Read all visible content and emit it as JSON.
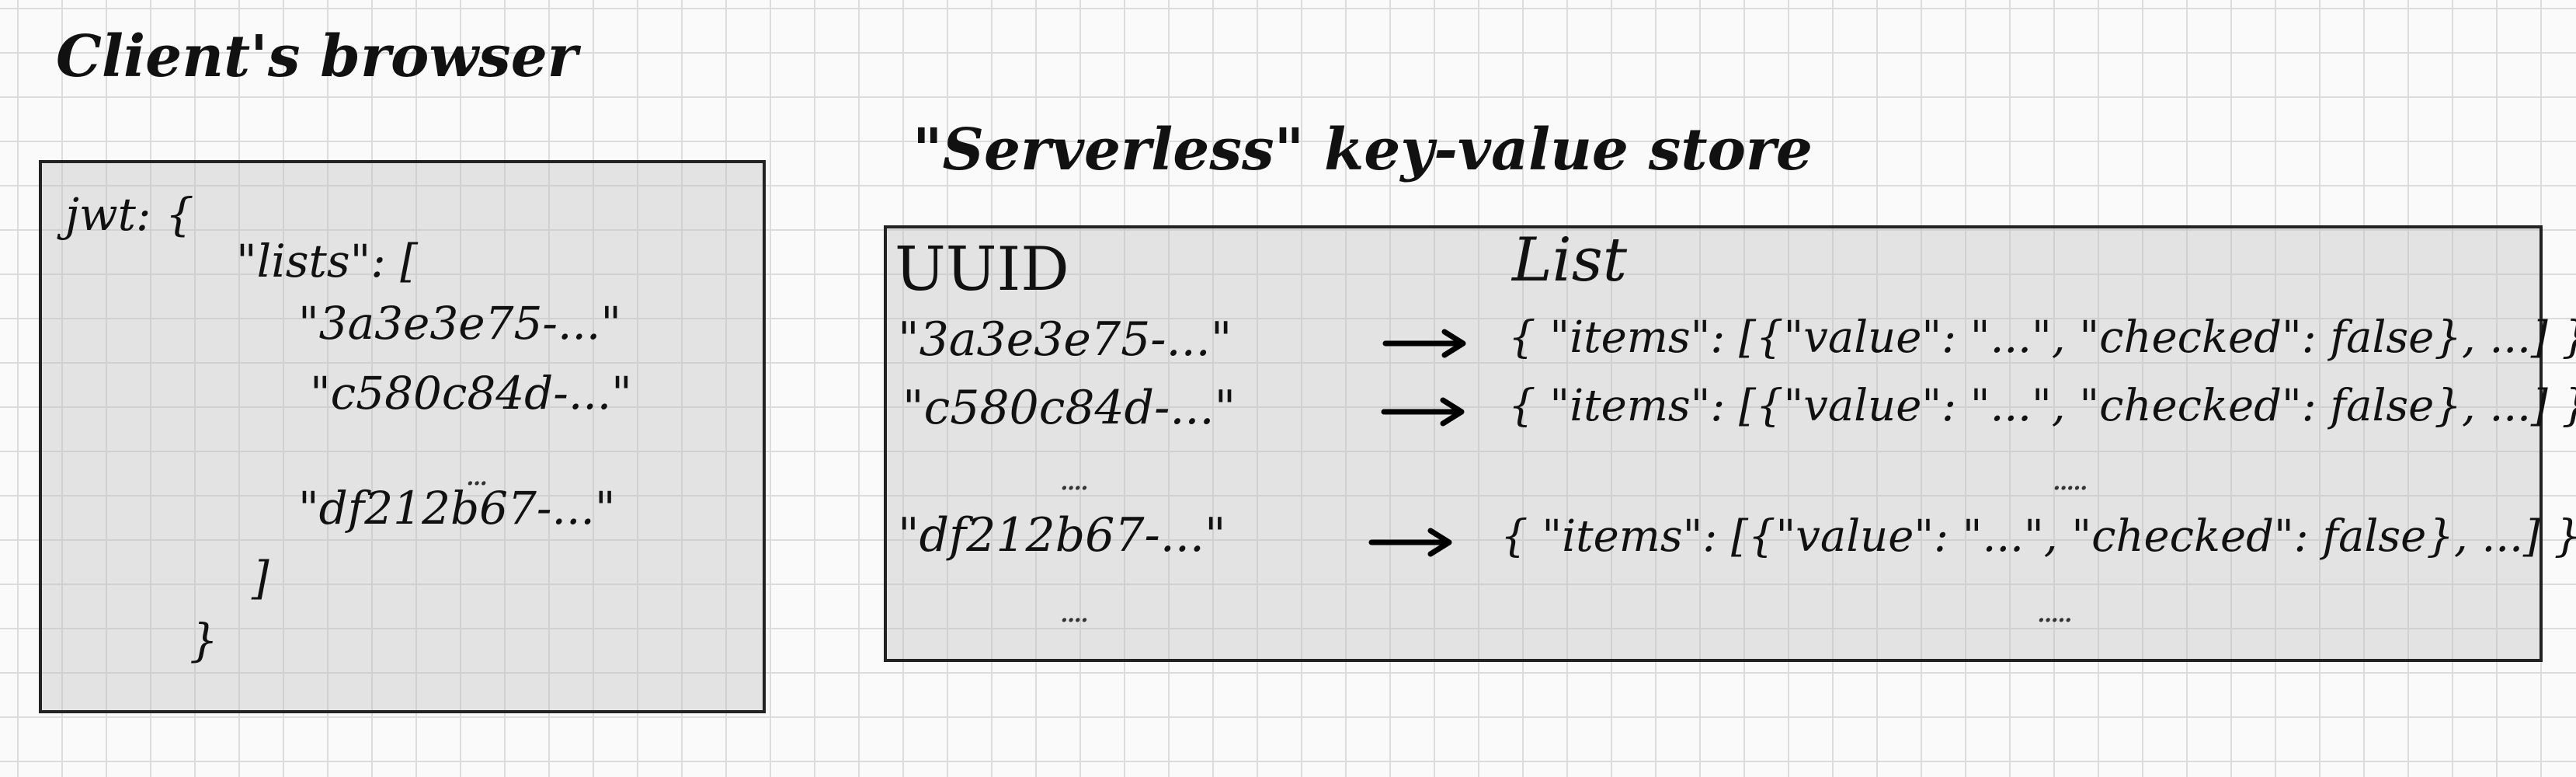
{
  "client": {
    "title": "Client's browser",
    "lines": [
      "jwt: {",
      "\"lists\": [",
      "\"3a3e3e75-...\"",
      "\"c580c84d-...\"",
      "...",
      "\"df212b67-...\"",
      "]",
      "}"
    ]
  },
  "store": {
    "title": "\"Serverless\" key-value store",
    "header_uuid": "UUID",
    "header_list": "List",
    "rows": [
      {
        "uuid": "\"3a3e3e75-...\"",
        "value": "{ \"items\": [{\"value\": \"...\", \"checked\": false}, ...] }"
      },
      {
        "uuid": "\"c580c84d-...\"",
        "value": "{ \"items\": [{\"value\": \"...\", \"checked\": false}, ...] }"
      },
      {
        "uuid": "\"df212b67-...\"",
        "value": "{ \"items\": [{\"value\": \"...\", \"checked\": false}, ...] }"
      }
    ],
    "ellipsis_uuid": "....",
    "ellipsis_list": "....."
  }
}
